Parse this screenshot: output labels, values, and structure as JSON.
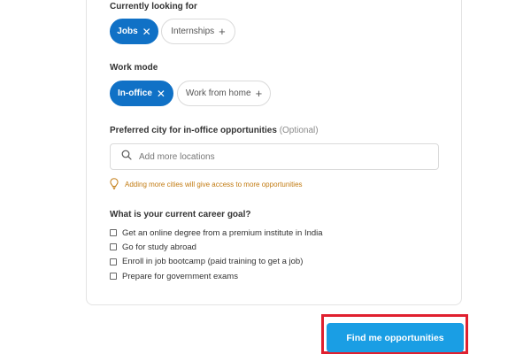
{
  "looking_for": {
    "label": "Currently looking for",
    "chips": [
      {
        "label": "Jobs",
        "selected": true
      },
      {
        "label": "Internships",
        "selected": false
      }
    ]
  },
  "work_mode": {
    "label": "Work mode",
    "chips": [
      {
        "label": "In-office",
        "selected": true
      },
      {
        "label": "Work from home",
        "selected": false
      }
    ]
  },
  "preferred_city": {
    "label": "Preferred city for in-office opportunities",
    "optional": "(Optional)",
    "placeholder": "Add more locations",
    "value": "",
    "hint": "Adding more cities will give access to more opportunities"
  },
  "career_goal": {
    "label": "What is your current career goal?",
    "options": [
      {
        "label": "Get an online degree from a premium institute in India",
        "checked": false
      },
      {
        "label": "Go for study abroad",
        "checked": false
      },
      {
        "label": "Enroll in job bootcamp (paid training to get a job)",
        "checked": false
      },
      {
        "label": "Prepare for government exams",
        "checked": false
      }
    ]
  },
  "cta": {
    "label": "Find me opportunities"
  },
  "icons": {
    "remove": "close-icon",
    "add": "plus-icon",
    "search": "search-icon",
    "hint": "lightbulb-icon"
  },
  "colors": {
    "primary": "#1071c6",
    "cta": "#1a9ee4",
    "hint": "#c27b12",
    "highlight": "#e0202f"
  }
}
